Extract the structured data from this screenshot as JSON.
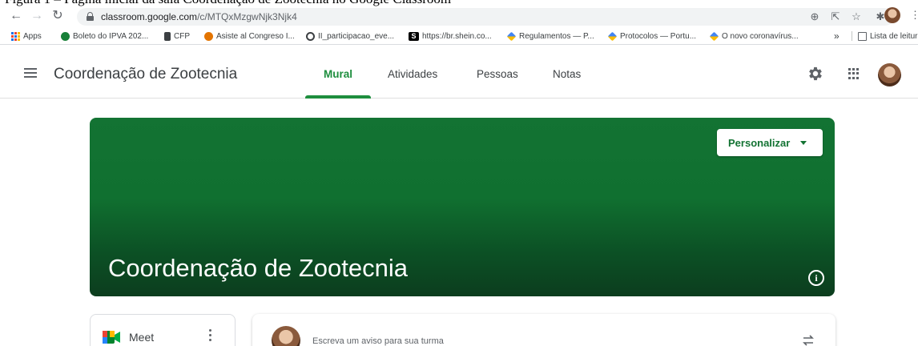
{
  "caption": "Figura 1 – Página inicial da sala Coordenação de Zootecnia no Google Classroom",
  "browser": {
    "url_host": "classroom.google.com",
    "url_path": "/c/MTQxMzgwNjk3Njk4"
  },
  "bookmarks": [
    {
      "label": "Apps",
      "color": "#1a73e8"
    },
    {
      "label": "Boleto do IPVA 202...",
      "color": "#188038"
    },
    {
      "label": "CFP",
      "color": "#3c4043"
    },
    {
      "label": "Asiste al Congreso I...",
      "color": "#e37400"
    },
    {
      "label": "II_participacao_eve...",
      "color": "#3c4043"
    },
    {
      "label": "https://br.shein.co...",
      "color": "#000000"
    },
    {
      "label": "Regulamentos — P...",
      "color": "#4285f4"
    },
    {
      "label": "Protocolos — Portu...",
      "color": "#4285f4"
    },
    {
      "label": "O novo coronavírus...",
      "color": "#4285f4"
    }
  ],
  "bookmarks_overflow": "»",
  "reading_list": "Lista de leitura",
  "header": {
    "title": "Coordenação de Zootecnia",
    "tabs": [
      "Mural",
      "Atividades",
      "Pessoas",
      "Notas"
    ],
    "active_tab": "Mural"
  },
  "banner": {
    "customize_label": "Personalizar",
    "title": "Coordenação de Zootecnia",
    "color": "#137333"
  },
  "meet": {
    "label": "Meet"
  },
  "post": {
    "placeholder": "Escreva um aviso para sua turma"
  }
}
